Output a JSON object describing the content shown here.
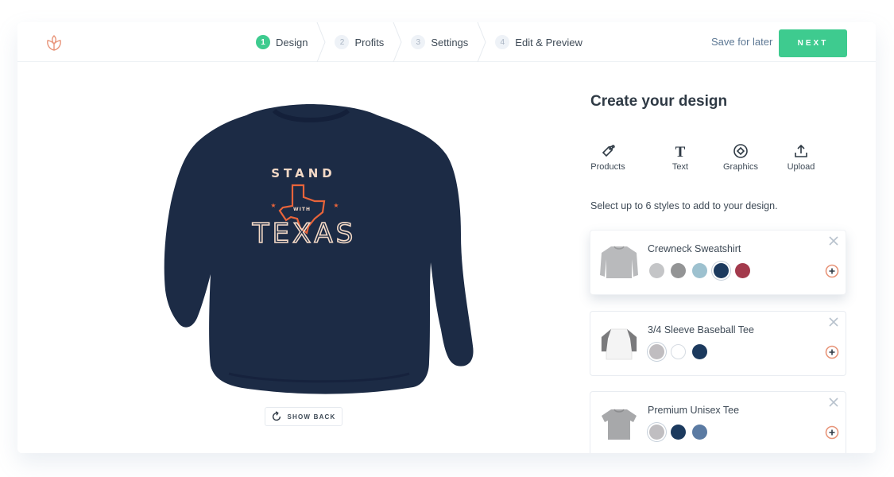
{
  "header": {
    "logo": "leaf-logo-icon",
    "steps": [
      {
        "number": "1",
        "label": "Design",
        "active": true
      },
      {
        "number": "2",
        "label": "Profits",
        "active": false
      },
      {
        "number": "3",
        "label": "Settings",
        "active": false
      },
      {
        "number": "4",
        "label": "Edit & Preview",
        "active": false
      }
    ],
    "save_label": "Save for later",
    "next_label": "NEXT"
  },
  "preview": {
    "product": "Crewneck Sweatshirt",
    "product_color": "#1c2b45",
    "design_text": {
      "top": "STAND",
      "middle": "WITH",
      "bottom": "TEXAS"
    },
    "show_back_label": "SHOW BACK"
  },
  "panel": {
    "title": "Create your design",
    "tools": [
      {
        "icon": "tag-icon",
        "label": "Products"
      },
      {
        "icon": "text-icon",
        "label": "Text"
      },
      {
        "icon": "graphics-icon",
        "label": "Graphics"
      },
      {
        "icon": "upload-icon",
        "label": "Upload"
      }
    ],
    "hint": "Select up to 6 styles to add to your design.",
    "styles": [
      {
        "name": "Crewneck Sweatshirt",
        "thumb": "sweatshirt",
        "colors": [
          "#c4c5c7",
          "#939495",
          "#9dc1cf",
          "#1c3a5e",
          "#a33a4c"
        ],
        "selected_index": 3
      },
      {
        "name": "3/4 Sleeve Baseball Tee",
        "thumb": "raglan",
        "colors": [
          "#c0bdc0",
          "#ffffff",
          "#1c3a5e"
        ],
        "selected_index": 0
      },
      {
        "name": "Premium Unisex Tee",
        "thumb": "tee",
        "colors": [
          "#c0bec1",
          "#1c3a5e",
          "#5b7ba3"
        ],
        "selected_index": 0
      }
    ]
  },
  "colors": {
    "accent": "#3ecb8f",
    "link": "#5d7894",
    "logo": "#e8957a"
  }
}
